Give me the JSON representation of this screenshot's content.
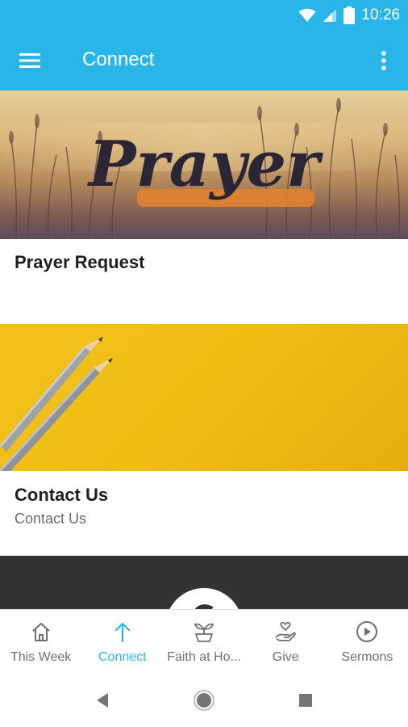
{
  "status_bar": {
    "time": "10:26",
    "icons": [
      "wifi-icon",
      "signal-icon",
      "battery-icon"
    ]
  },
  "app_bar": {
    "title": "Connect",
    "menu_icon": "hamburger-menu-icon",
    "overflow_icon": "more-vert-icon"
  },
  "cards": [
    {
      "image_word": "Prayer",
      "title": "Prayer Request",
      "subtitle": ""
    },
    {
      "title": "Contact Us",
      "subtitle": "Contact Us"
    }
  ],
  "bottom_nav": {
    "active_index": 1,
    "items": [
      {
        "label": "This Week",
        "icon": "home-icon"
      },
      {
        "label": "Connect",
        "icon": "arrow-up-icon"
      },
      {
        "label": "Faith at Ho...",
        "icon": "seedling-icon"
      },
      {
        "label": "Give",
        "icon": "giving-hand-icon"
      },
      {
        "label": "Sermons",
        "icon": "play-circle-icon"
      }
    ]
  },
  "colors": {
    "primary": "#29b5e8",
    "active_tab": "#29b5e8",
    "inactive_tab": "#6f6f6f",
    "contact_banner": "#f0bc14",
    "dark_card": "#333333"
  },
  "system_nav": [
    "back-icon",
    "home-circle-icon",
    "recents-icon"
  ]
}
